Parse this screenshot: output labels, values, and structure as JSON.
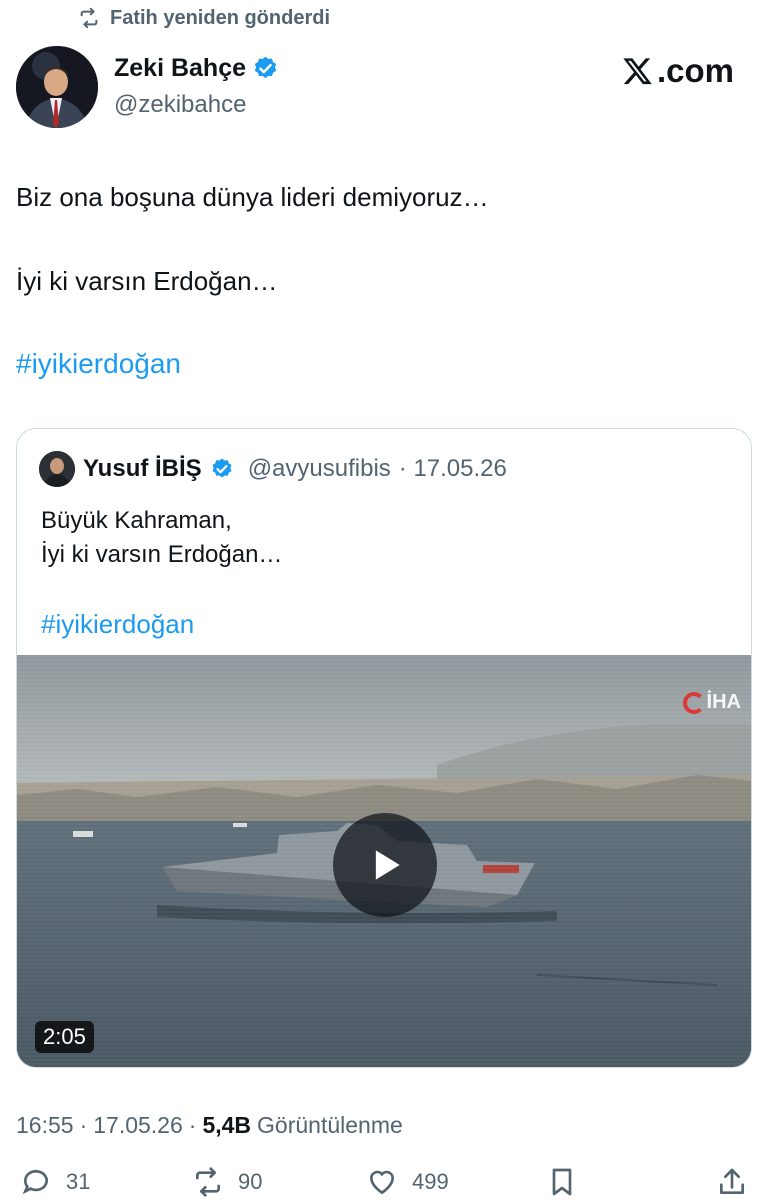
{
  "retweet": {
    "text": "Fatih yeniden gönderdi"
  },
  "author": {
    "name": "Zeki Bahçe",
    "handle": "@zekibahce",
    "verified": true
  },
  "brand": {
    "logo_text": ".com"
  },
  "tweet": {
    "line1": "Biz ona boşuna dünya lideri demiyoruz…",
    "line2": "İyi ki varsın Erdoğan…",
    "hashtag": "#iyikierdoğan"
  },
  "quote": {
    "name": "Yusuf İBİŞ",
    "handle": "@avyusufibis",
    "date": "· 17.05.26",
    "line1": "Büyük Kahraman,",
    "line2": "İyi ki varsın Erdoğan…",
    "hashtag": "#iyikierdoğan",
    "video": {
      "duration": "2:05",
      "watermark": "İHA"
    }
  },
  "meta": {
    "time": "16:55",
    "date": "17.05.26",
    "views_count": "5,4B",
    "views_label": "Görüntülenme"
  },
  "actions": {
    "replies": "31",
    "retweets": "90",
    "likes": "499"
  },
  "colors": {
    "accent": "#1d9bf0",
    "muted": "#536471",
    "text": "#0f1419",
    "border": "#cfd9de"
  }
}
